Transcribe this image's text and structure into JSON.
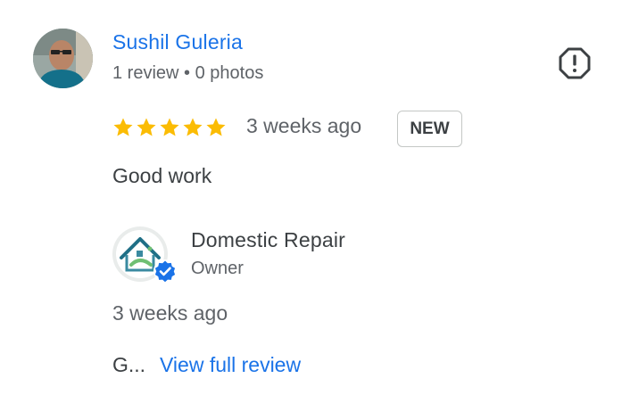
{
  "review": {
    "reviewer_name": "Sushil Guleria",
    "reviewer_meta": "1 review • 0 photos",
    "rating": 5,
    "rating_max": 5,
    "date": "3 weeks ago",
    "badge": "NEW",
    "text": "Good work",
    "report_icon": "report-flag-icon"
  },
  "owner_response": {
    "name": "Domestic Repair",
    "role": "Owner",
    "date": "3 weeks ago",
    "preview": "G...",
    "view_full_label": "View full review",
    "verified_icon": "verified-badge-icon"
  },
  "colors": {
    "link": "#1a73e8",
    "star": "#fbbc04",
    "text": "#3c4043",
    "secondary": "#5f6368",
    "badge_border": "#c4c7c5",
    "verified": "#1a73e8"
  }
}
